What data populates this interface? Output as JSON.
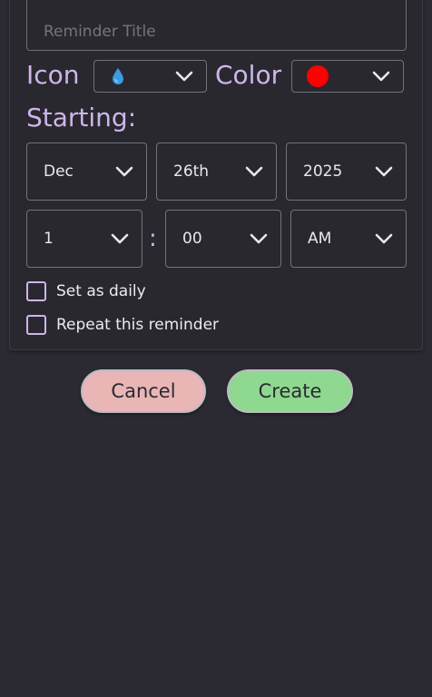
{
  "form": {
    "title_placeholder": "Reminder Title",
    "icon_label": "Icon",
    "icon_value": "water-drop-icon",
    "color_label": "Color",
    "color_value": "#ff0000",
    "starting_label": "Starting:",
    "month": "Dec",
    "day": "26th",
    "year": "2025",
    "hour": "1",
    "time_separator": ":",
    "minute": "00",
    "ampm": "AM",
    "daily_label": "Set as daily",
    "repeat_label": "Repeat this reminder"
  },
  "actions": {
    "cancel_label": "Cancel",
    "create_label": "Create",
    "cancel_color": "#eab5b5",
    "create_color": "#8fd88f"
  },
  "theme": {
    "background": "#2b2a33",
    "accent": "#cdb6ea"
  }
}
